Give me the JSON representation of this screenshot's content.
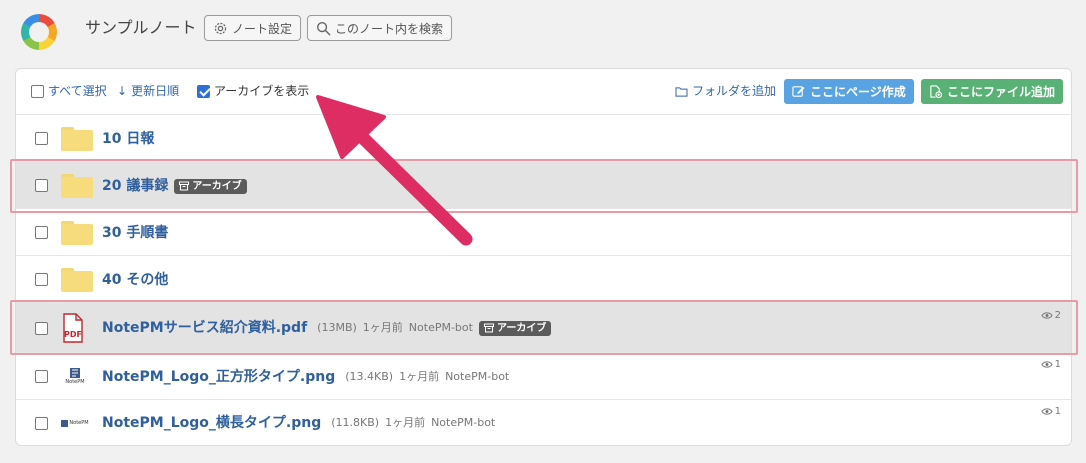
{
  "header": {
    "note_title": "サンプルノート",
    "settings_label": "ノート設定",
    "search_label": "このノート内を検索"
  },
  "toolbar": {
    "select_all": "すべて選択",
    "sort_label": "更新日順",
    "show_archive": "アーカイブを表示",
    "add_folder": "フォルダを追加",
    "create_page": "ここにページ作成",
    "add_file": "ここにファイル追加"
  },
  "colors": {
    "accent_blue": "#5aa3e2",
    "accent_green": "#5ab176",
    "link": "#2f5f9e",
    "highlight": "#e89aa6",
    "arrow": "#dd2d62"
  },
  "items": [
    {
      "type": "folder",
      "name": "10 日報",
      "archived": false
    },
    {
      "type": "folder",
      "name": "20 議事録",
      "archived": true,
      "badge": "アーカイブ"
    },
    {
      "type": "folder",
      "name": "30 手順書",
      "archived": false
    },
    {
      "type": "folder",
      "name": "40 その他",
      "archived": false
    },
    {
      "type": "pdf",
      "name": "NotePMサービス紹介資料.pdf",
      "size": "(13MB)",
      "updated": "1ヶ月前",
      "author": "NotePM-bot",
      "archived": true,
      "badge": "アーカイブ",
      "views": "2",
      "icon_text": "PDF"
    },
    {
      "type": "png",
      "name": "NotePM_Logo_正方形タイプ.png",
      "size": "(13.4KB)",
      "updated": "1ヶ月前",
      "author": "NotePM-bot",
      "archived": false,
      "views": "1",
      "icon_text": "NotePM"
    },
    {
      "type": "png",
      "name": "NotePM_Logo_横長タイプ.png",
      "size": "(11.8KB)",
      "updated": "1ヶ月前",
      "author": "NotePM-bot",
      "archived": false,
      "views": "1",
      "icon_text": "NotePM"
    }
  ]
}
